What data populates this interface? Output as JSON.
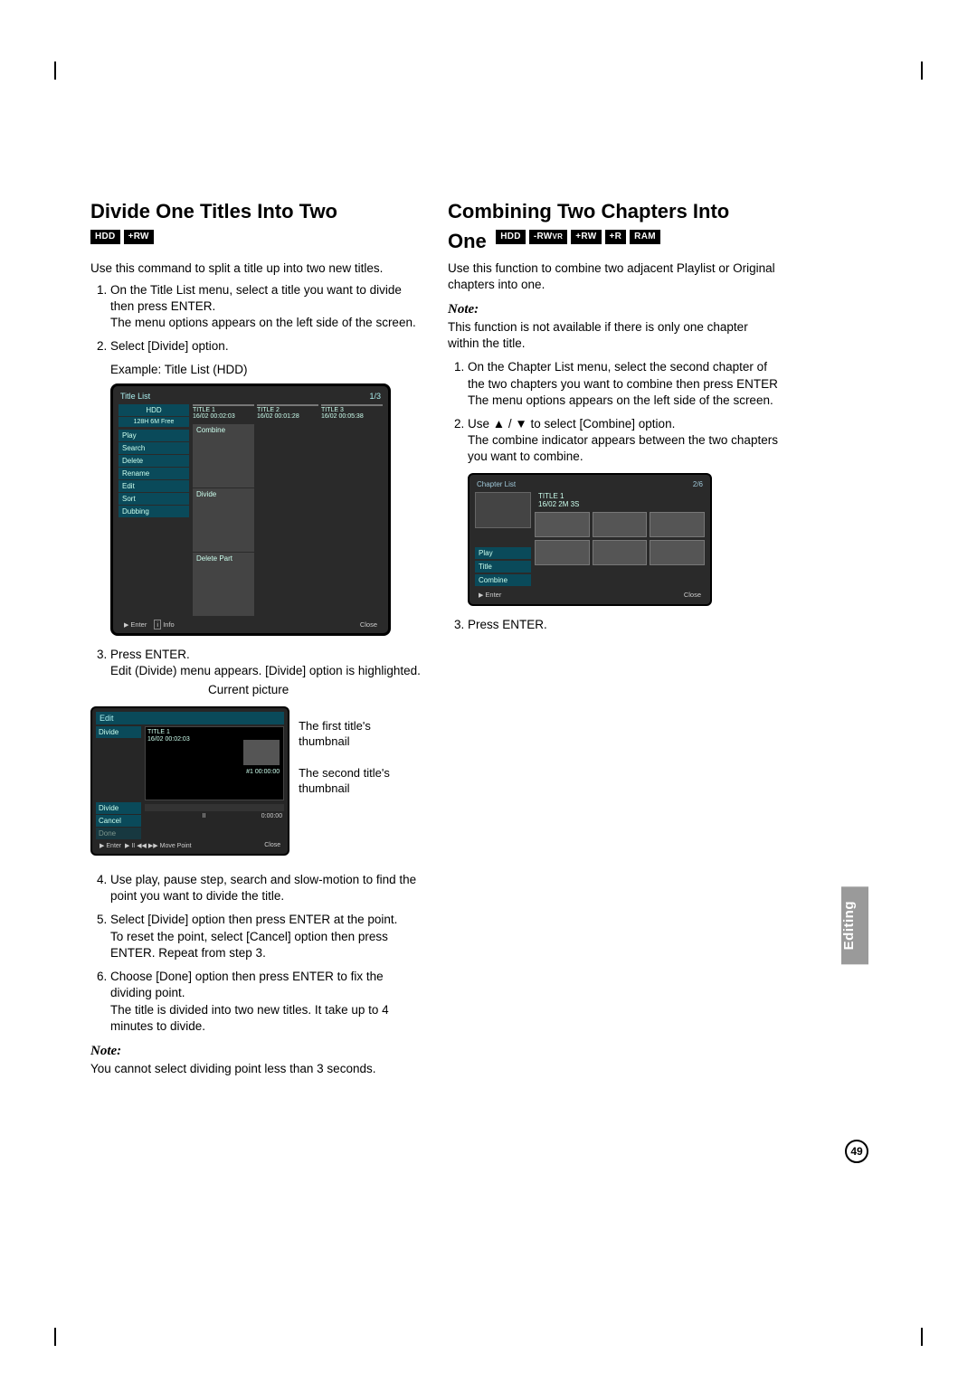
{
  "side_tab": "Editing",
  "page_number": "49",
  "left": {
    "heading": "Divide One Titles Into Two",
    "badges": [
      "HDD",
      "+RW"
    ],
    "intro": "Use this command to split a title up into two new titles.",
    "steps": [
      "On the Title List menu, select a title you want to divide then press ENTER.\nThe menu options appears on the left side of the screen.",
      "Select [Divide] option.",
      "Press ENTER.\nEdit (Divide) menu appears. [Divide] option is highlighted.",
      "Use play, pause step, search and slow-motion to find the point you want to divide the title.",
      "Select [Divide] option then press ENTER at the point.\nTo reset the point, select [Cancel] option then press ENTER. Repeat from step 3.",
      "Choose [Done] option then press ENTER to fix the dividing point.\nThe title is divided into two new titles. It take up to 4 minutes to divide."
    ],
    "example_line": "Example: Title List (HDD)",
    "note_heading": "Note:",
    "note_text": "You cannot select dividing point less than 3 seconds.",
    "current_picture_label": "Current picture",
    "callout1": "The first title's thumbnail",
    "callout2": "The second title's thumbnail",
    "ss1": {
      "title": "Title List",
      "count": "1/3",
      "hdd": "HDD",
      "free": "128H 6M Free",
      "menu": [
        "Play",
        "Search",
        "Delete",
        "Rename",
        "Edit",
        "Sort",
        "Dubbing"
      ],
      "submenu": [
        "Combine",
        "Divide",
        "Delete Part"
      ],
      "thumbs": [
        {
          "t": "TITLE 1",
          "d": "16/02  00:02:03"
        },
        {
          "t": "TITLE 2",
          "d": "16/02  00:01:28"
        },
        {
          "t": "TITLE 3",
          "d": "16/02  00:05:38"
        }
      ],
      "footer_left": "Enter",
      "footer_center": "Info",
      "footer_right": "Close"
    },
    "ss2": {
      "top": "Edit",
      "side": [
        "Divide",
        "Divide",
        "Cancel",
        "Done"
      ],
      "info_title": "TITLE 1",
      "info_date": "16/02  00:02:03",
      "mini_label": "#1   00:00:00",
      "time": "0:00:00",
      "pause": "II",
      "footer_left": "Enter",
      "footer_mid": "Move Point",
      "footer_right": "Close"
    }
  },
  "right": {
    "heading_line1": "Combining Two Chapters Into",
    "heading_word_one": "One",
    "badges": [
      "HDD",
      "-RWVR",
      "+RW",
      "+R",
      "RAM"
    ],
    "intro": "Use this function to combine two adjacent Playlist or Original chapters into one.",
    "note_heading": "Note:",
    "note_text": "This function is not available if there is only one chapter within the title.",
    "steps": [
      "On the Chapter List menu, select the second chapter of the two chapters you want to combine then press ENTER\nThe menu options appears on the left side of the screen.",
      "Use ▲ / ▼ to select [Combine] option.\nThe combine indicator appears between the two chapters you want to combine.",
      "Press ENTER."
    ],
    "ss": {
      "title": "Chapter List",
      "count": "2/6",
      "info_title": "TITLE 1",
      "info_date": "16/02  2M 3S",
      "menu": [
        "Play",
        "Title",
        "Combine"
      ],
      "footer_left": "Enter",
      "footer_right": "Close"
    }
  }
}
